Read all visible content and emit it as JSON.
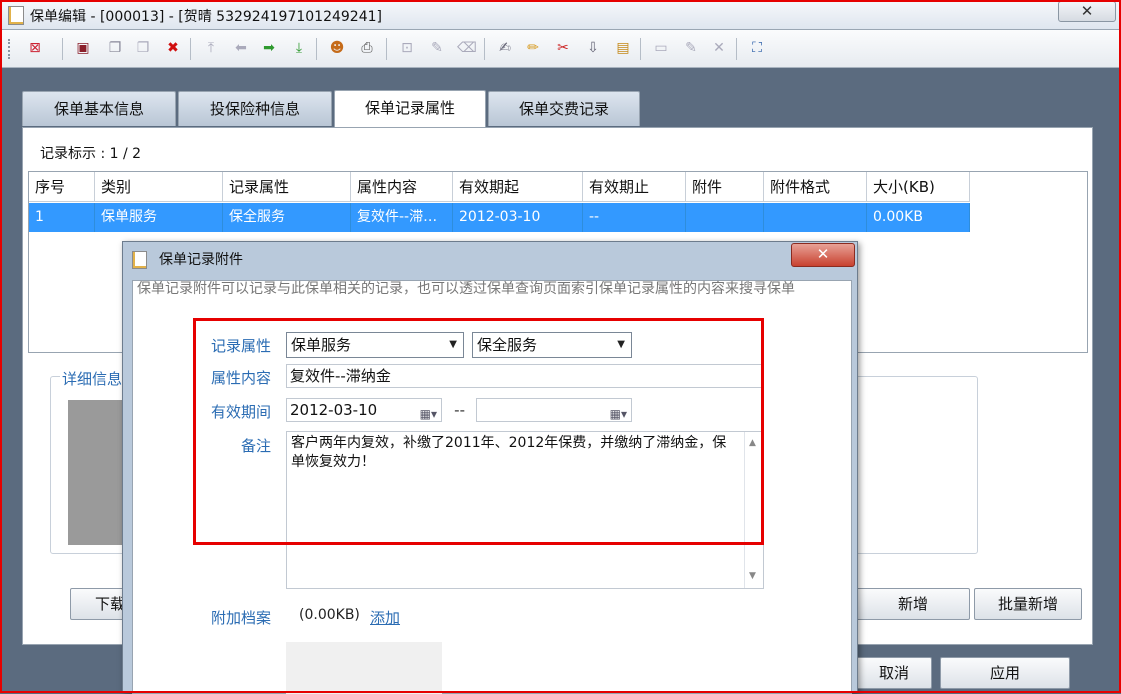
{
  "window": {
    "title": "保单编辑 - [000013] - [贺晴 532924197101249241]",
    "close_glyph": "✕"
  },
  "toolbar": {
    "items": [
      {
        "name": "exit-icon",
        "glyph": "⊠",
        "color": "#c23"
      },
      {
        "name": "save-icon",
        "glyph": "▣",
        "color": "#8a1f2a"
      },
      {
        "name": "copy-icon",
        "glyph": "❐",
        "color": "#889"
      },
      {
        "name": "paste-icon",
        "glyph": "❐",
        "color": "#aab"
      },
      {
        "name": "delete-icon",
        "glyph": "✖",
        "color": "#d10f0f"
      },
      {
        "name": "move-top-icon",
        "glyph": "⤒",
        "color": "#aab"
      },
      {
        "name": "arrow-left-icon",
        "glyph": "⬅",
        "color": "#aab"
      },
      {
        "name": "arrow-right-icon",
        "glyph": "➡",
        "color": "#2f9a2f"
      },
      {
        "name": "move-bottom-icon",
        "glyph": "⤓",
        "color": "#2f9a2f"
      },
      {
        "name": "user-icon",
        "glyph": "☻",
        "color": "#c56b1a"
      },
      {
        "name": "print-icon",
        "glyph": "⎙",
        "color": "#555"
      },
      {
        "name": "export-icon",
        "glyph": "⊡",
        "color": "#aab"
      },
      {
        "name": "edit-icon",
        "glyph": "✎",
        "color": "#aab"
      },
      {
        "name": "clear-icon",
        "glyph": "⌫",
        "color": "#aab"
      },
      {
        "name": "note-icon",
        "glyph": "✍",
        "color": "#667"
      },
      {
        "name": "pencil-icon",
        "glyph": "✏",
        "color": "#d79a1e"
      },
      {
        "name": "cut-icon",
        "glyph": "✂",
        "color": "#c22"
      },
      {
        "name": "download-icon",
        "glyph": "⇩",
        "color": "#667"
      },
      {
        "name": "folder-icon",
        "glyph": "▤",
        "color": "#c58a1a"
      },
      {
        "name": "blank-icon",
        "glyph": "▭",
        "color": "#aab"
      },
      {
        "name": "edit-doc-icon",
        "glyph": "✎",
        "color": "#aab"
      },
      {
        "name": "remove-doc-icon",
        "glyph": "✕",
        "color": "#aab"
      },
      {
        "name": "fullscreen-icon",
        "glyph": "⛶",
        "color": "#2a5ea8"
      }
    ]
  },
  "tabs": [
    {
      "label": "保单基本信息"
    },
    {
      "label": "投保险种信息"
    },
    {
      "label": "保单记录属性"
    },
    {
      "label": "保单交费记录"
    }
  ],
  "record_indicator": "记录标示 : 1 / 2",
  "grid": {
    "headers": [
      "序号",
      "类别",
      "记录属性",
      "属性内容",
      "有效期起",
      "有效期止",
      "附件",
      "附件格式",
      "大小(KB)"
    ],
    "rows": [
      [
        "1",
        "保单服务",
        "保全服务",
        "复效件--滞…",
        "2012-03-10",
        "--",
        "",
        "",
        "0.00KB"
      ]
    ]
  },
  "detail": {
    "label": "详细信息"
  },
  "bottom_buttons": {
    "download": "下载",
    "add": "新增",
    "batch_add": "批量新增",
    "cancel": "取消",
    "apply": "应用"
  },
  "dialog": {
    "title": "保单记录附件",
    "close_glyph": "✕",
    "description": "保单记录附件可以记录与此保单相关的记录，也可以透过保单查询页面索引保单记录属性的内容来搜寻保单",
    "labels": {
      "record_attr": "记录属性",
      "attr_content": "属性内容",
      "valid_period": "有效期间",
      "remark": "备注",
      "attachment": "附加档案"
    },
    "category_value": "保单服务",
    "subcategory_value": "保全服务",
    "attr_content_value": "复效件--滞纳金",
    "date_from": "2012-03-10",
    "date_sep": "--",
    "date_to": "",
    "remark_value": "客户两年内复效，补缴了2011年、2012年保费，并缴纳了滞纳金，保单恢复效力！",
    "attachment_size": "(0.00KB)",
    "attachment_add": "添加"
  },
  "highlight_color": "#e60000"
}
